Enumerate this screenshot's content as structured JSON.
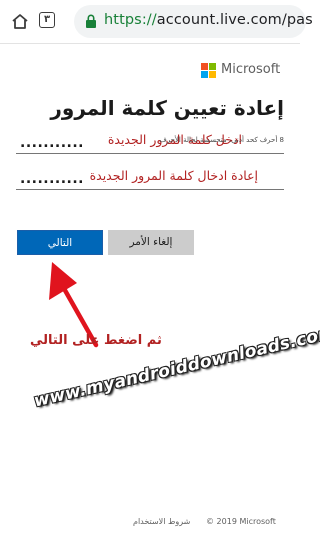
{
  "browser": {
    "tab_count": "٣",
    "url_scheme": "https://",
    "url_rest": "account.live.com/pas",
    "icons": [
      "home-icon",
      "lock-icon"
    ]
  },
  "brand": {
    "name": "Microsoft",
    "logo_colors": [
      "#f25022",
      "#7fba00",
      "#00a4ef",
      "#ffb900"
    ]
  },
  "form": {
    "title": "إعادة تعيين كلمة المرور",
    "new_password": {
      "value": "...........",
      "annotation": "ادخل كلمة المرور الجديدة"
    },
    "hint": "8 أحرف كحد أدنى، متحسسة لحالة الأحرف",
    "confirm_password": {
      "value": "...........",
      "annotation": "إعادة ادخال كلمة المرور الجديدة"
    },
    "next_label": "التالي",
    "cancel_label": "إلغاء الأمر"
  },
  "annotations": {
    "instruction": "ثم اضغط على التالي",
    "watermark": "www.myandroiddownloads.com",
    "accent_color": "#e0141e"
  },
  "footer": {
    "copyright": "© 2019 Microsoft",
    "terms": "شروط الاستخدام"
  }
}
